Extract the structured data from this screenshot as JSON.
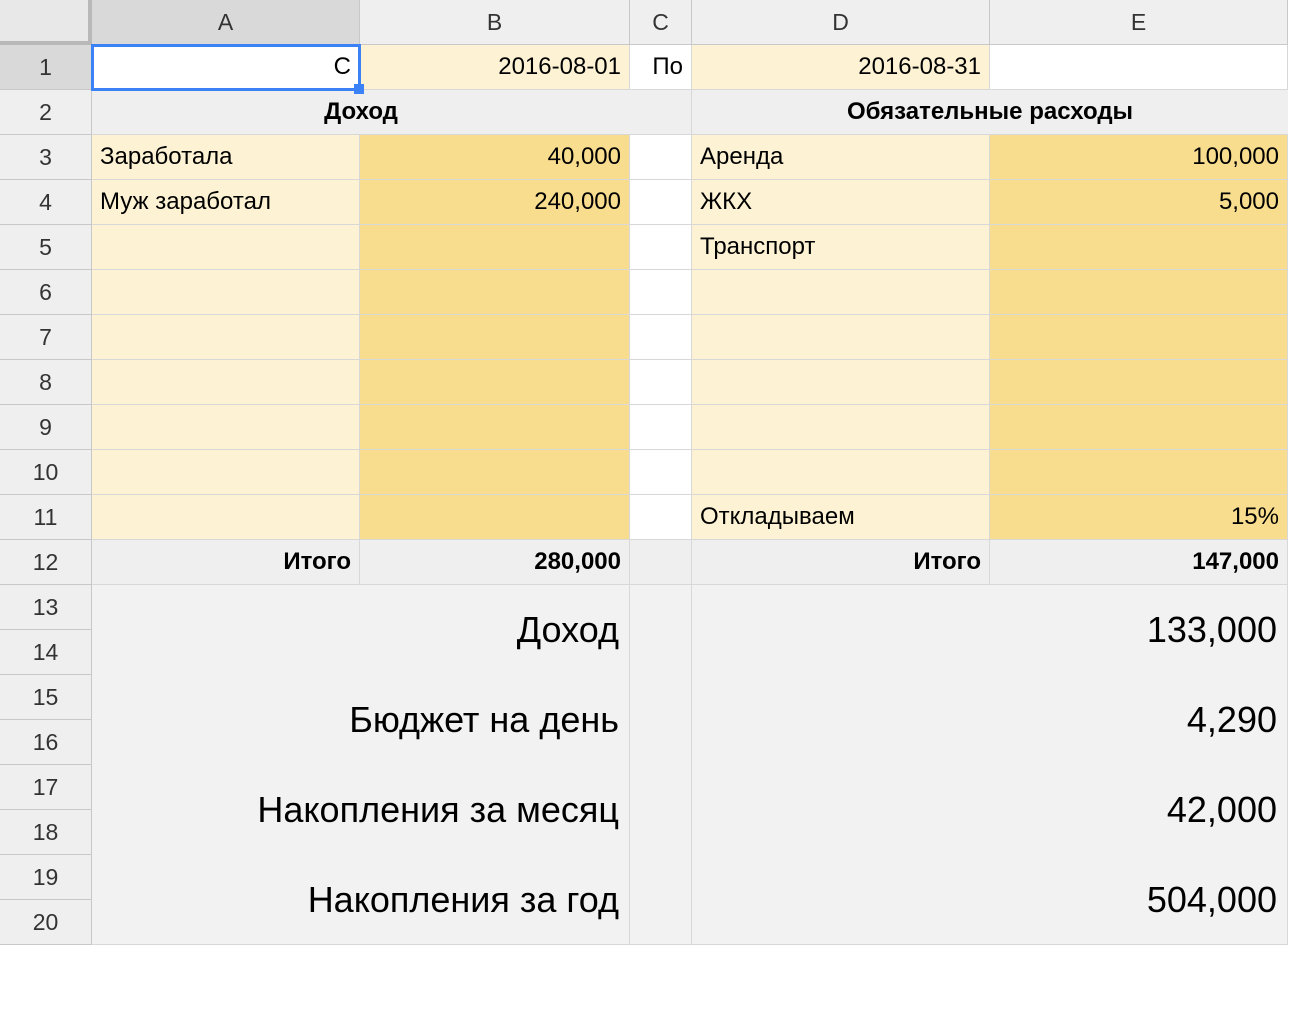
{
  "columns": [
    "A",
    "B",
    "C",
    "D",
    "E"
  ],
  "rowCount": 20,
  "row1": {
    "A": "С",
    "B": "2016-08-01",
    "C": "По",
    "D": "2016-08-31"
  },
  "headers": {
    "income": "Доход",
    "expenses": "Обязательные расходы"
  },
  "income": [
    {
      "label": "Заработала",
      "value": "40,000"
    },
    {
      "label": "Муж заработал",
      "value": "240,000"
    },
    {
      "label": "",
      "value": ""
    },
    {
      "label": "",
      "value": ""
    },
    {
      "label": "",
      "value": ""
    },
    {
      "label": "",
      "value": ""
    },
    {
      "label": "",
      "value": ""
    },
    {
      "label": "",
      "value": ""
    },
    {
      "label": "",
      "value": ""
    }
  ],
  "expenses": [
    {
      "label": "Аренда",
      "value": "100,000"
    },
    {
      "label": "ЖКХ",
      "value": "5,000"
    },
    {
      "label": "Транспорт",
      "value": ""
    },
    {
      "label": "",
      "value": ""
    },
    {
      "label": "",
      "value": ""
    },
    {
      "label": "",
      "value": ""
    },
    {
      "label": "",
      "value": ""
    },
    {
      "label": "",
      "value": ""
    },
    {
      "label": "Откладываем",
      "value": "15%"
    }
  ],
  "totals": {
    "label": "Итого",
    "income": "280,000",
    "expenses": "147,000"
  },
  "summary": [
    {
      "label": "Доход",
      "value": "133,000"
    },
    {
      "label": "Бюджет на день",
      "value": "4,290"
    },
    {
      "label": "Накопления за месяц",
      "value": "42,000"
    },
    {
      "label": "Накопления за год",
      "value": "504,000"
    }
  ]
}
